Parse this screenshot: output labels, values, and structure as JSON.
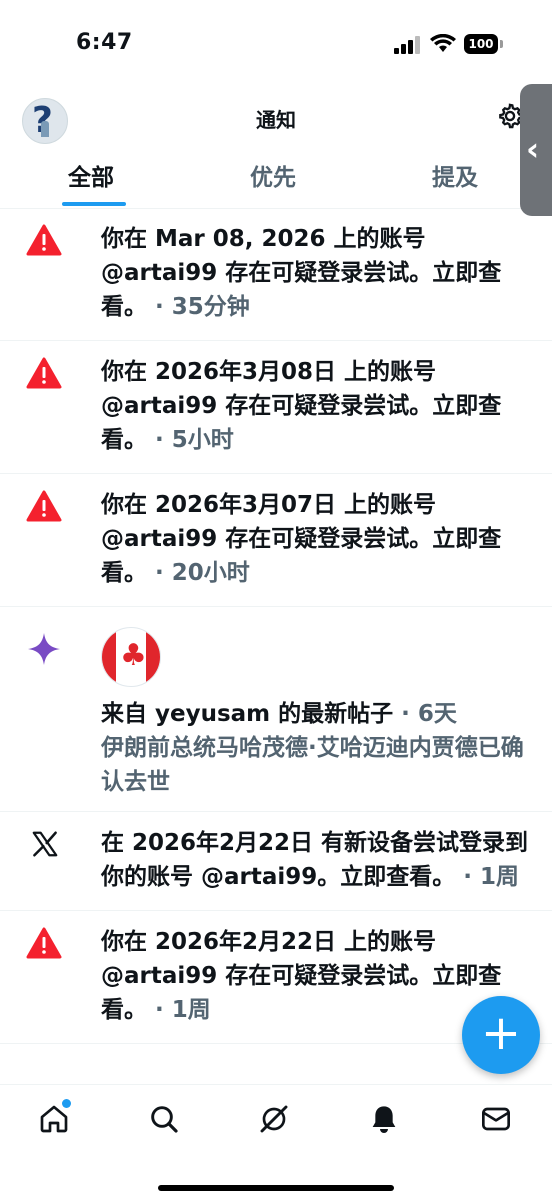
{
  "status_bar": {
    "time": "6:47",
    "battery": "100"
  },
  "header": {
    "title": "通知",
    "tabs": [
      {
        "label": "全部",
        "active": true
      },
      {
        "label": "优先",
        "active": false
      },
      {
        "label": "提及",
        "active": false
      }
    ]
  },
  "notifications": [
    {
      "icon": "alert-icon",
      "text": "你在 Mar 08, 2026 上的账号 @artai99 存在可疑登录尝试。立即查看。",
      "time": " · 35分钟"
    },
    {
      "icon": "alert-icon",
      "text": "你在 2026年3月08日 上的账号 @artai99 存在可疑登录尝试。立即查看。",
      "time": " · 5小时"
    },
    {
      "icon": "alert-icon",
      "text": "你在 2026年3月07日 上的账号 @artai99 存在可疑登录尝试。立即查看。",
      "time": " · 20小时"
    },
    {
      "icon": "sparkle-icon",
      "avatar": "canada-flag",
      "text": "来自 yeyusam 的最新帖子",
      "time": " · 6天",
      "sub": "伊朗前总统马哈茂德·艾哈迈迪内贾德已确认去世"
    },
    {
      "icon": "x-logo-icon",
      "text": "在 2026年2月22日 有新设备尝试登录到你的账号 @artai99。立即查看。",
      "time": " · 1周"
    },
    {
      "icon": "alert-icon",
      "text": "你在 2026年2月22日 上的账号 @artai99 存在可疑登录尝试。立即查看。",
      "time": " · 1周"
    }
  ],
  "fab": {
    "label": "+"
  },
  "bottom_nav": [
    {
      "name": "home-icon",
      "has_dot": true
    },
    {
      "name": "search-icon"
    },
    {
      "name": "grok-icon"
    },
    {
      "name": "notifications-icon",
      "active": true
    },
    {
      "name": "messages-icon"
    }
  ],
  "colors": {
    "accent": "#1d9bf0",
    "alert": "#f4212e",
    "sparkle": "#794bc4",
    "secondary_text": "#536471"
  }
}
